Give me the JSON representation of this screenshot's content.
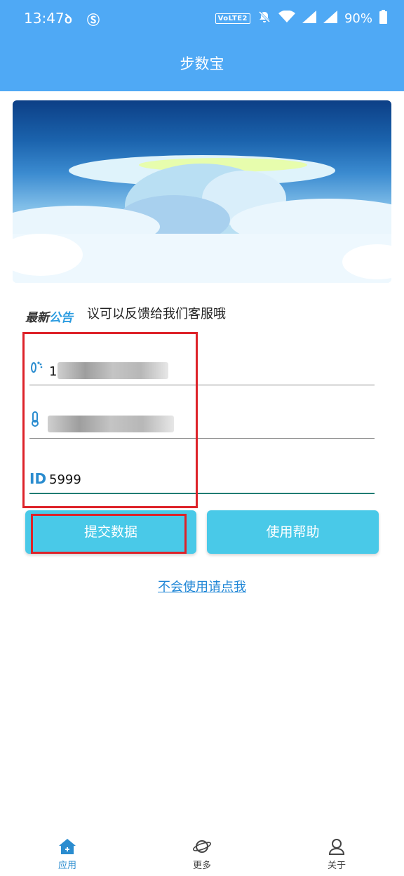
{
  "status_bar": {
    "time": "13:47",
    "volte": "VoLTE2",
    "battery": "90%"
  },
  "app_bar": {
    "title": "步数宝"
  },
  "notice": {
    "logo_part1": "最新",
    "logo_part2": "公告",
    "text": "议可以反馈给我们客服哦"
  },
  "form": {
    "account": {
      "value": "1",
      "icon": "footprint-icon"
    },
    "password": {
      "icon": "thermometer-icon"
    },
    "id": {
      "label": "ID",
      "value": "5999"
    }
  },
  "buttons": {
    "submit": "提交数据",
    "help": "使用帮助"
  },
  "help_link": "不会使用请点我",
  "bottom_nav": [
    {
      "label": "应用",
      "icon": "home-icon",
      "active": true
    },
    {
      "label": "更多",
      "icon": "planet-icon",
      "active": false
    },
    {
      "label": "关于",
      "icon": "person-icon",
      "active": false
    }
  ],
  "colors": {
    "primary": "#4fa9f5",
    "button": "#49c9e8",
    "accent_blue": "#2a8ccf",
    "highlight_red": "#dd2229"
  }
}
